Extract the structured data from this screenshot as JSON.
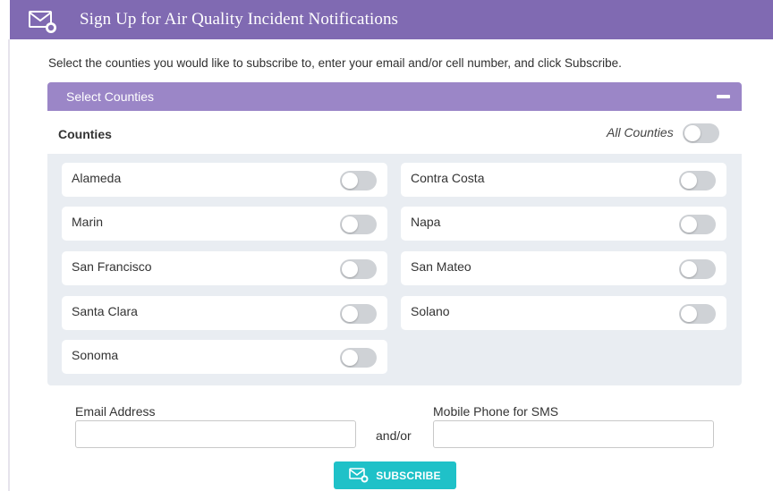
{
  "header": {
    "title": "Sign Up for Air Quality Incident Notifications",
    "icon": "envelope-icon"
  },
  "intro": "Select the counties you would like to subscribe to, enter your email and/or cell number, and click Subscribe.",
  "panel": {
    "title": "Select Counties",
    "counties_label": "Counties",
    "all_label": "All Counties",
    "all_enabled": false
  },
  "counties": [
    {
      "name": "Alameda",
      "enabled": false
    },
    {
      "name": "Contra Costa",
      "enabled": false
    },
    {
      "name": "Marin",
      "enabled": false
    },
    {
      "name": "Napa",
      "enabled": false
    },
    {
      "name": "San Francisco",
      "enabled": false
    },
    {
      "name": "San Mateo",
      "enabled": false
    },
    {
      "name": "Santa Clara",
      "enabled": false
    },
    {
      "name": "Solano",
      "enabled": false
    },
    {
      "name": "Sonoma",
      "enabled": false
    }
  ],
  "form": {
    "email_label": "Email Address",
    "email_value": "",
    "phone_label": "Mobile Phone for SMS",
    "phone_value": "",
    "andor": "and/or",
    "subscribe_label": "SUBSCRIBE"
  },
  "colors": {
    "header": "#806ab2",
    "panel_header": "#9b86c7",
    "panel_bg": "#e9edf2",
    "button": "#1fc1c8",
    "toggle_off": "#cfd2d6"
  }
}
